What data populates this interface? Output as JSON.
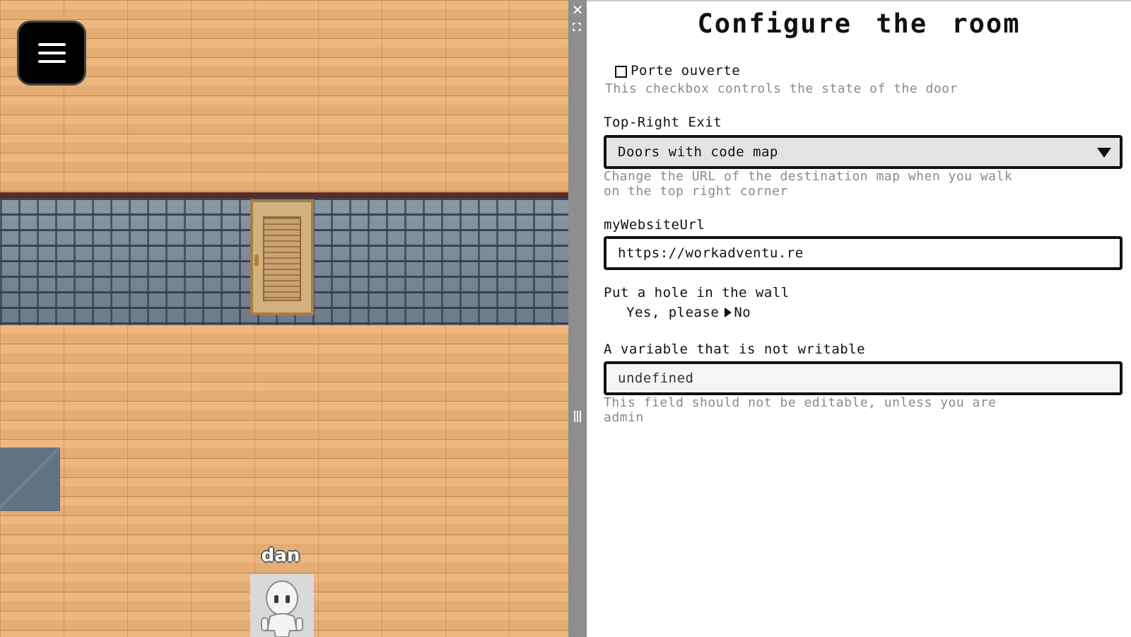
{
  "game": {
    "menu_icon": "hamburger-menu-icon",
    "player": {
      "name": "dan",
      "avatar_icon": "white-humanoid-avatar"
    }
  },
  "splitter": {
    "close_label": "✕",
    "close_icon": "close-icon",
    "expand_icon": "expand-icon",
    "resize_icon": "resize-handle-icon"
  },
  "panel": {
    "title": "Configure the room",
    "door_checkbox": {
      "label": "Porte ouverte",
      "checked": false,
      "help": "This checkbox controls the state of the door"
    },
    "exit_select": {
      "label": "Top-Right Exit",
      "value": "Doors with code map",
      "help_line1": "Change the URL of the destination map when you walk",
      "help_line2": "on the top right corner"
    },
    "website_url": {
      "label": "myWebsiteUrl",
      "value": "https://workadventu.re"
    },
    "hole_radio": {
      "label": "Put a hole in the wall",
      "options": [
        "Yes, please",
        "No"
      ],
      "selected": "No"
    },
    "readonly_var": {
      "label": "A variable that is not writable",
      "value": "undefined",
      "help_line1": "This field should not be editable, unless you are",
      "help_line2": "admin"
    }
  },
  "colors": {
    "floor": "#e9b37b",
    "wall": "#7b8796",
    "splitter": "#8e8e8e",
    "panel_bg": "#ffffff",
    "help_text": "#8a8a8a"
  }
}
